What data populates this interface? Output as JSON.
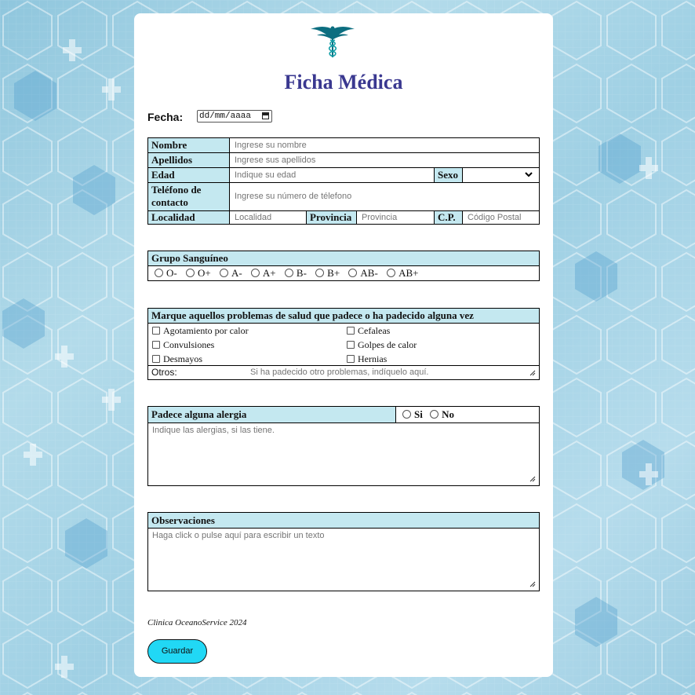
{
  "title": "Ficha Médica",
  "fecha": {
    "label": "Fecha:",
    "placeholder": "dd/mm/aaaa"
  },
  "personal": {
    "nombre": {
      "label": "Nombre",
      "placeholder": "Ingrese su nombre"
    },
    "apellidos": {
      "label": "Apellidos",
      "placeholder": "Ingrese sus apellidos"
    },
    "edad": {
      "label": "Edad",
      "placeholder": "Indique su edad"
    },
    "sexo": {
      "label": "Sexo",
      "value": ""
    },
    "telefono": {
      "label_line1": "Teléfono de",
      "label_line2": "contacto",
      "placeholder": "Ingrese su número de télefono"
    },
    "localidad": {
      "label": "Localidad",
      "placeholder": "Localidad"
    },
    "provincia": {
      "label": "Provincia",
      "placeholder": "Provincia"
    },
    "cp": {
      "label": "C.P.",
      "placeholder": "Código Postal"
    }
  },
  "blood": {
    "header": "Grupo Sanguíneo",
    "options": [
      "O-",
      "O+",
      "A-",
      "A+",
      "B-",
      "B+",
      "AB-",
      "AB+"
    ]
  },
  "health": {
    "header": "Marque aquellos problemas de salud que padece o ha padecido alguna vez",
    "left": [
      "Agotamiento por calor",
      "Convulsiones",
      "Desmayos"
    ],
    "right": [
      "Cefaleas",
      "Golpes de calor",
      "Hernias"
    ],
    "otros_label": "Otros:",
    "otros_placeholder": "Si ha padecido otro problemas, indíquelo aquí."
  },
  "allergy": {
    "header": "Padece alguna alergia",
    "yes": "Si",
    "no": "No",
    "placeholder": "Indique las alergias, si las tiene."
  },
  "observaciones": {
    "header": "Observaciones",
    "placeholder": "Haga click o pulse aquí para escribir un texto"
  },
  "footer": "Clinica OceanoService 2024",
  "submit_label": "Guardar",
  "colors": {
    "accent": "#21d8f5",
    "label_bg": "#c4e8f0",
    "title": "#3a3890"
  },
  "icons": {
    "logo": "caduceus-icon"
  }
}
